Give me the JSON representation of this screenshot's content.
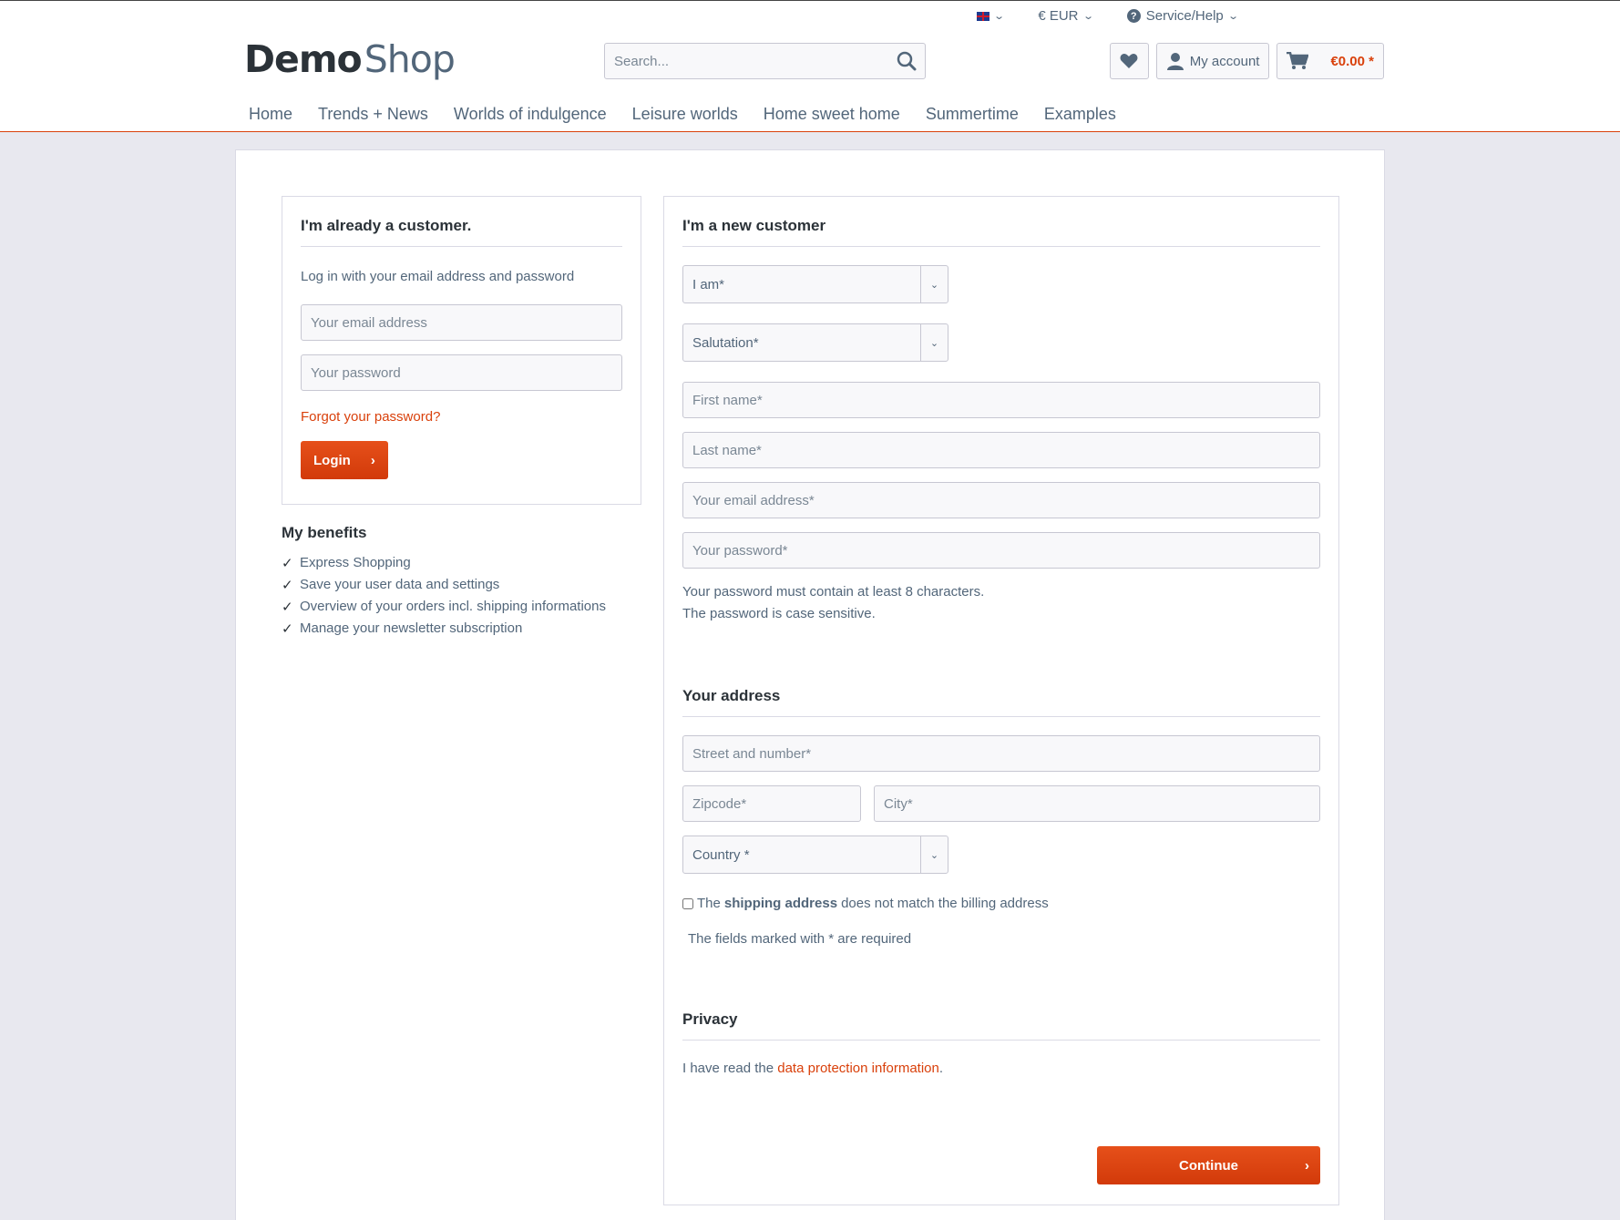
{
  "topbar": {
    "currency": "€ EUR",
    "service": "Service/Help"
  },
  "logo": {
    "part1": "Demo",
    "part2": "Shop"
  },
  "search": {
    "placeholder": "Search..."
  },
  "header_actions": {
    "account": "My account",
    "cart_total": "€0.00 *"
  },
  "nav": [
    "Home",
    "Trends + News",
    "Worlds of indulgence",
    "Leisure worlds",
    "Home sweet home",
    "Summertime",
    "Examples"
  ],
  "login": {
    "title": "I'm already a customer.",
    "lead": "Log in with your email address and password",
    "email_placeholder": "Your email address",
    "password_placeholder": "Your password",
    "forgot": "Forgot your password?",
    "button": "Login"
  },
  "benefits": {
    "title": "My benefits",
    "items": [
      "Express Shopping",
      "Save your user data and settings",
      "Overview of your orders incl. shipping informations",
      "Manage your newsletter subscription"
    ]
  },
  "register": {
    "title": "I'm a new customer",
    "customer_type": "I am*",
    "salutation": "Salutation*",
    "first_name": "First name*",
    "last_name": "Last name*",
    "email": "Your email address*",
    "password": "Your password*",
    "pw_hint1": "Your password must contain at least 8 characters.",
    "pw_hint2": "The password is case sensitive.",
    "address_title": "Your address",
    "street": "Street and number*",
    "zip": "Zipcode*",
    "city": "City*",
    "country": "Country *",
    "shipping_pre": "The",
    "shipping_bold": "shipping address",
    "shipping_post": "does not match the billing address",
    "required_note": "The fields marked with * are required",
    "privacy_title": "Privacy",
    "privacy_pre": "I have read the",
    "privacy_link": "data protection information",
    "privacy_post": ".",
    "continue": "Continue"
  },
  "colors": {
    "accent": "#d9400b",
    "text": "#52667a",
    "heading": "#2b3238",
    "background": "#e8e8ef"
  }
}
